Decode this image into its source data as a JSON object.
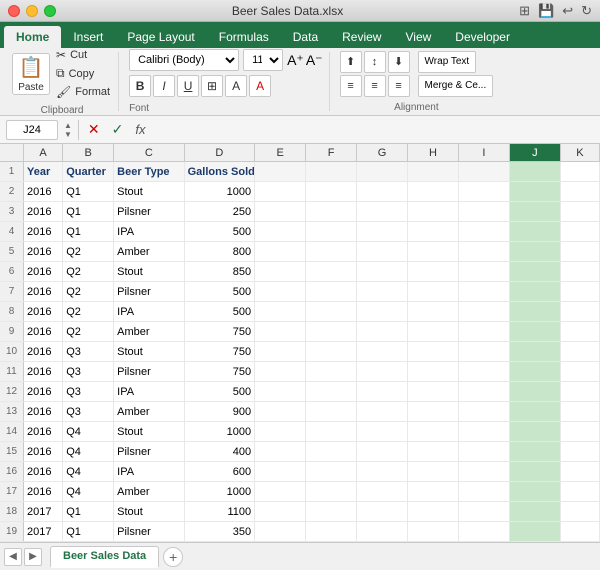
{
  "titlebar": {
    "title": "Beer Sales Data.xlsx"
  },
  "ribbon": {
    "tabs": [
      "Home",
      "Insert",
      "Page Layout",
      "Formulas",
      "Data",
      "Review",
      "View",
      "Developer"
    ],
    "active_tab": "Home",
    "paste_label": "Paste",
    "cut_label": "Cut",
    "copy_label": "Copy",
    "format_label": "Format",
    "font_name": "Calibri (Body)",
    "font_size": "11",
    "wrap_text_label": "Wrap Text",
    "merge_label": "Merge & Ce..."
  },
  "formula_bar": {
    "cell_ref": "J24",
    "formula": ""
  },
  "columns": {
    "headers": [
      "",
      "A",
      "B",
      "C",
      "D",
      "E",
      "F",
      "G",
      "H",
      "I",
      "J",
      "K"
    ]
  },
  "rows": [
    {
      "num": 1,
      "a": "Year",
      "b": "Quarter",
      "c": "Beer Type",
      "d": "Gallons Sold",
      "e": "",
      "f": "",
      "g": "",
      "h": "",
      "i": "",
      "j": ""
    },
    {
      "num": 2,
      "a": "2016",
      "b": "Q1",
      "c": "Stout",
      "d": "1000",
      "e": "",
      "f": "",
      "g": "",
      "h": "",
      "i": "",
      "j": ""
    },
    {
      "num": 3,
      "a": "2016",
      "b": "Q1",
      "c": "Pilsner",
      "d": "250",
      "e": "",
      "f": "",
      "g": "",
      "h": "",
      "i": "",
      "j": ""
    },
    {
      "num": 4,
      "a": "2016",
      "b": "Q1",
      "c": "IPA",
      "d": "500",
      "e": "",
      "f": "",
      "g": "",
      "h": "",
      "i": "",
      "j": ""
    },
    {
      "num": 5,
      "a": "2016",
      "b": "Q2",
      "c": "Amber",
      "d": "800",
      "e": "",
      "f": "",
      "g": "",
      "h": "",
      "i": "",
      "j": ""
    },
    {
      "num": 6,
      "a": "2016",
      "b": "Q2",
      "c": "Stout",
      "d": "850",
      "e": "",
      "f": "",
      "g": "",
      "h": "",
      "i": "",
      "j": ""
    },
    {
      "num": 7,
      "a": "2016",
      "b": "Q2",
      "c": "Pilsner",
      "d": "500",
      "e": "",
      "f": "",
      "g": "",
      "h": "",
      "i": "",
      "j": ""
    },
    {
      "num": 8,
      "a": "2016",
      "b": "Q2",
      "c": "IPA",
      "d": "500",
      "e": "",
      "f": "",
      "g": "",
      "h": "",
      "i": "",
      "j": ""
    },
    {
      "num": 9,
      "a": "2016",
      "b": "Q2",
      "c": "Amber",
      "d": "750",
      "e": "",
      "f": "",
      "g": "",
      "h": "",
      "i": "",
      "j": ""
    },
    {
      "num": 10,
      "a": "2016",
      "b": "Q3",
      "c": "Stout",
      "d": "750",
      "e": "",
      "f": "",
      "g": "",
      "h": "",
      "i": "",
      "j": ""
    },
    {
      "num": 11,
      "a": "2016",
      "b": "Q3",
      "c": "Pilsner",
      "d": "750",
      "e": "",
      "f": "",
      "g": "",
      "h": "",
      "i": "",
      "j": ""
    },
    {
      "num": 12,
      "a": "2016",
      "b": "Q3",
      "c": "IPA",
      "d": "500",
      "e": "",
      "f": "",
      "g": "",
      "h": "",
      "i": "",
      "j": ""
    },
    {
      "num": 13,
      "a": "2016",
      "b": "Q3",
      "c": "Amber",
      "d": "900",
      "e": "",
      "f": "",
      "g": "",
      "h": "",
      "i": "",
      "j": ""
    },
    {
      "num": 14,
      "a": "2016",
      "b": "Q4",
      "c": "Stout",
      "d": "1000",
      "e": "",
      "f": "",
      "g": "",
      "h": "",
      "i": "",
      "j": ""
    },
    {
      "num": 15,
      "a": "2016",
      "b": "Q4",
      "c": "Pilsner",
      "d": "400",
      "e": "",
      "f": "",
      "g": "",
      "h": "",
      "i": "",
      "j": ""
    },
    {
      "num": 16,
      "a": "2016",
      "b": "Q4",
      "c": "IPA",
      "d": "600",
      "e": "",
      "f": "",
      "g": "",
      "h": "",
      "i": "",
      "j": ""
    },
    {
      "num": 17,
      "a": "2016",
      "b": "Q4",
      "c": "Amber",
      "d": "1000",
      "e": "",
      "f": "",
      "g": "",
      "h": "",
      "i": "",
      "j": ""
    },
    {
      "num": 18,
      "a": "2017",
      "b": "Q1",
      "c": "Stout",
      "d": "1100",
      "e": "",
      "f": "",
      "g": "",
      "h": "",
      "i": "",
      "j": ""
    },
    {
      "num": 19,
      "a": "2017",
      "b": "Q1",
      "c": "Pilsner",
      "d": "350",
      "e": "",
      "f": "",
      "g": "",
      "h": "",
      "i": "",
      "j": ""
    }
  ],
  "sheet_tabs": {
    "active": "Beer Sales Data",
    "sheets": [
      "Beer Sales Data"
    ]
  }
}
